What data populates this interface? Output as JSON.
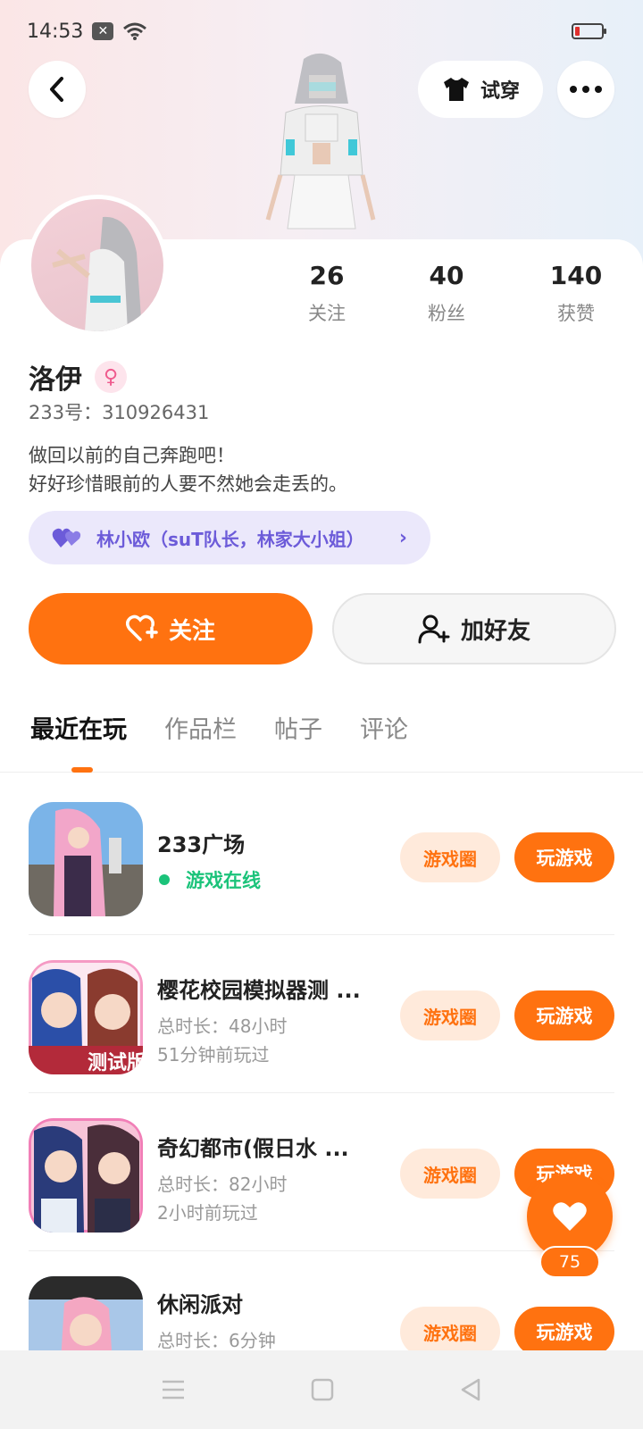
{
  "status_bar": {
    "time": "14:53"
  },
  "header": {
    "tryon_label": "试穿"
  },
  "profile": {
    "name": "洛伊",
    "gender_symbol": "♀",
    "uid": "233号：310926431",
    "bio_line1": "做回以前的自己奔跑吧！",
    "bio_line2": "好好珍惜眼前的人要不然她会走丢的。",
    "cp_text": "林小欧（suT队长，林家大小姐）",
    "stats": [
      {
        "value": "26",
        "label": "关注"
      },
      {
        "value": "40",
        "label": "粉丝"
      },
      {
        "value": "140",
        "label": "获赞"
      }
    ]
  },
  "actions": {
    "follow_label": "关注",
    "add_friend_label": "加好友"
  },
  "tabs": [
    "最近在玩",
    "作品栏",
    "帖子",
    "评论"
  ],
  "games": [
    {
      "title": "233广场",
      "status": "游戏在线",
      "circle": "游戏圈",
      "play": "玩游戏"
    },
    {
      "title": "樱花校园模拟器测 ...",
      "duration": "总时长：48小时",
      "last": "51分钟前玩过",
      "badge": "测试版",
      "circle": "游戏圈",
      "play": "玩游戏"
    },
    {
      "title": "奇幻都市(假日水 ...",
      "duration": "总时长：82小时",
      "last": "2小时前玩过",
      "circle": "游戏圈",
      "play": "玩游戏"
    },
    {
      "title": "休闲派对",
      "duration": "总时长：6分钟",
      "circle": "游戏圈",
      "play": "玩游戏"
    }
  ],
  "fab": {
    "count": "75"
  },
  "colors": {
    "accent": "#ff7210",
    "online": "#1bc37a",
    "cp_purple": "#6c5bd9"
  }
}
